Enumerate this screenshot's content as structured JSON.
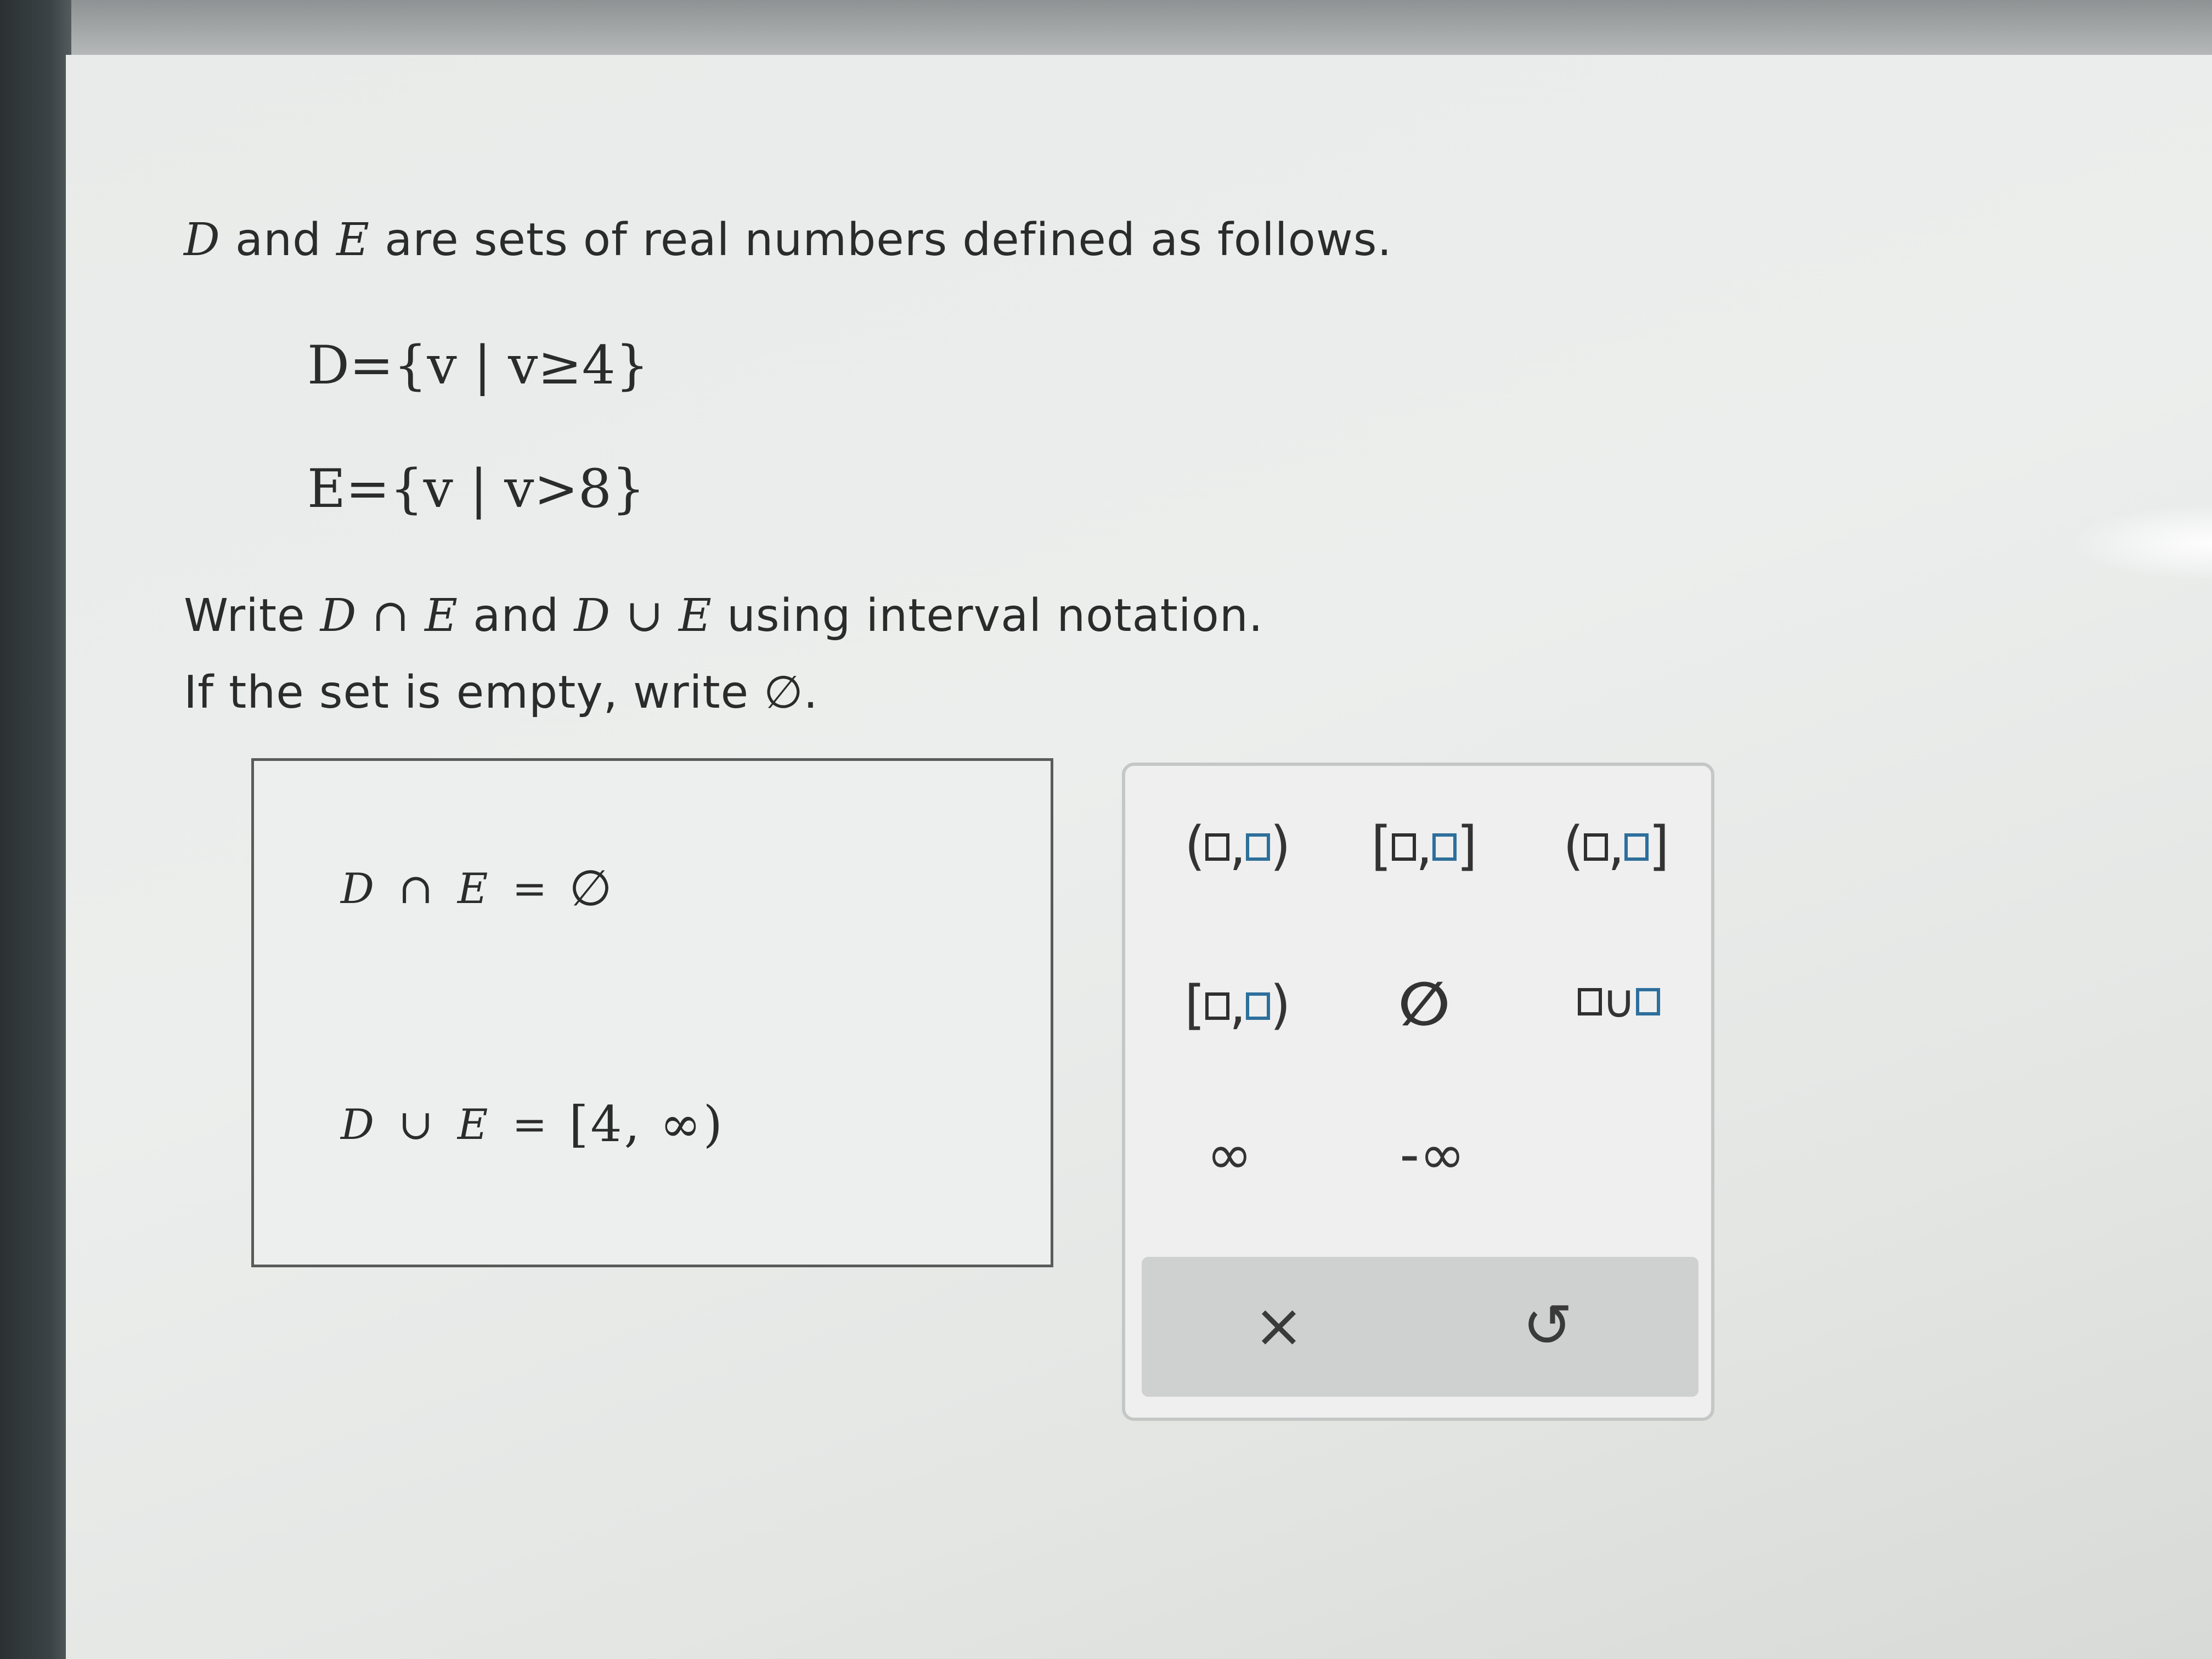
{
  "problem": {
    "intro_set1": "D",
    "intro_and": " and ",
    "intro_set2": "E",
    "intro_rest": " are sets of real numbers defined as follows.",
    "def_d": "D={v | v≥4}",
    "def_e": "E={v | v>8}",
    "instruction_prefix": "Write ",
    "instruction_intersection": "D ∩ E",
    "instruction_and": " and ",
    "instruction_union": "D ∪ E",
    "instruction_suffix": " using interval notation.",
    "empty_note": "If the set is empty, write ∅."
  },
  "answers": {
    "intersection_label": "D ∩ E =",
    "intersection_value": "∅",
    "union_label": "D ∪ E =",
    "union_value": "[4, ∞)"
  },
  "keypad": {
    "keys": [
      {
        "name": "open-open-interval",
        "left": "(",
        "sep": ",",
        "right": ")"
      },
      {
        "name": "closed-closed-interval",
        "left": "[",
        "sep": ",",
        "right": "]"
      },
      {
        "name": "open-closed-interval",
        "left": "(",
        "sep": ",",
        "right": "]"
      },
      {
        "name": "closed-open-interval",
        "left": "[",
        "sep": ",",
        "right": ")"
      }
    ],
    "empty_set": "∅",
    "union_symbol": "∪",
    "infinity": "∞",
    "neg_infinity": "-∞",
    "clear": "×",
    "undo": "↺"
  }
}
